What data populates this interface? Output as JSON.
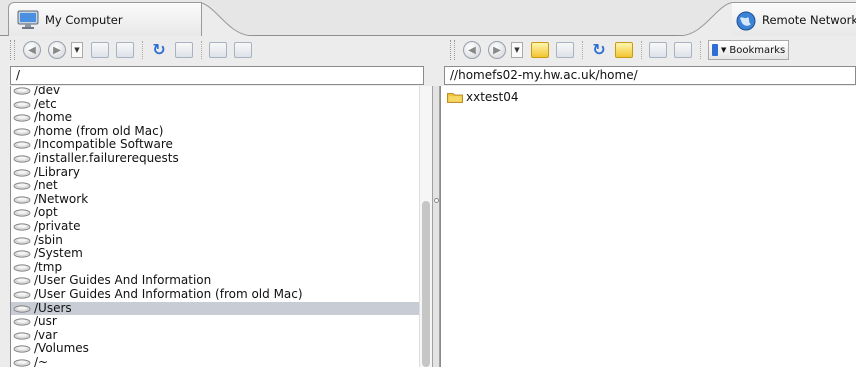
{
  "tabs": {
    "local_title": "My Computer",
    "remote_title": "Remote Network"
  },
  "left": {
    "path": "/",
    "items": [
      {
        "label": "/dev"
      },
      {
        "label": "/etc"
      },
      {
        "label": "/home"
      },
      {
        "label": "/home (from old Mac)"
      },
      {
        "label": "/Incompatible Software"
      },
      {
        "label": "/installer.failurerequests"
      },
      {
        "label": "/Library"
      },
      {
        "label": "/net"
      },
      {
        "label": "/Network"
      },
      {
        "label": "/opt"
      },
      {
        "label": "/private"
      },
      {
        "label": "/sbin"
      },
      {
        "label": "/System"
      },
      {
        "label": "/tmp"
      },
      {
        "label": "/User Guides And Information"
      },
      {
        "label": "/User Guides And Information (from old Mac)"
      },
      {
        "label": "/Users",
        "selected": true
      },
      {
        "label": "/usr"
      },
      {
        "label": "/var"
      },
      {
        "label": "/Volumes"
      },
      {
        "label": "/~"
      }
    ]
  },
  "right": {
    "path": "//homefs02-my.hw.ac.uk/home/",
    "items": [
      {
        "label": "xxtest04",
        "icon": "folder-icon"
      }
    ],
    "bookmarks_label": "Bookmarks"
  },
  "colors": {
    "selection": "#c7ccd5",
    "folder": "#f0c23a",
    "accent_blue": "#2f6fd3"
  }
}
